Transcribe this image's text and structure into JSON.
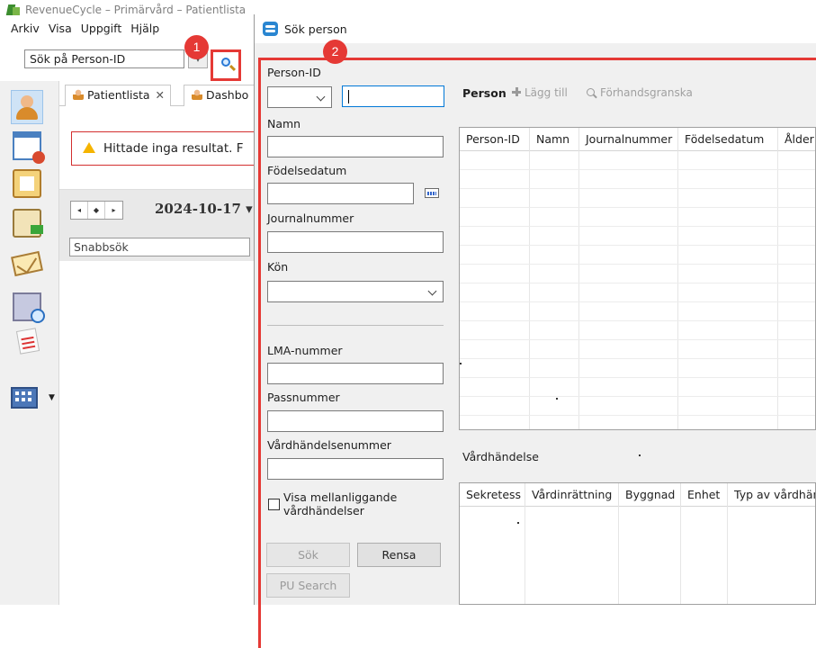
{
  "app": {
    "window_title": "RevenueCycle – Primärvård – Patientlista",
    "menu": [
      "Arkiv",
      "Visa",
      "Uppgift",
      "Hjälp"
    ],
    "search_placeholder": "Sök på Person-ID",
    "search_icon": "search-icon",
    "tabs": [
      {
        "label": "Patientlista",
        "close": "✕"
      },
      {
        "label": "Dashbo"
      }
    ],
    "alert_text": "Hittade inga resultat. F",
    "date": "2024-10-17",
    "date_nav": [
      "◂",
      "◆",
      "▸"
    ],
    "quick_search_placeholder": "Snabbsök",
    "sidebar_icons": [
      "user-search-icon",
      "calendar-clock-icon",
      "clipboard-icon",
      "paste-icon",
      "mail-icon",
      "building-search-icon",
      "note-icon",
      "building-grid-icon"
    ]
  },
  "markers": {
    "one": "1",
    "two": "2",
    "color": "#e53935"
  },
  "dialog": {
    "title": "Sök person",
    "form": {
      "person_id_label": "Person-ID",
      "person_id_value": "",
      "name_label": "Namn",
      "birthdate_label": "Födelsedatum",
      "journal_label": "Journalnummer",
      "gender_label": "Kön",
      "lma_label": "LMA-nummer",
      "passport_label": "Passnummer",
      "care_event_label": "Vårdhändelsenummer",
      "show_intermediate_label": "Visa mellanliggande vårdhändelser",
      "show_intermediate_checked": false,
      "search_button": "Sök",
      "clear_button": "Rensa",
      "pu_search_button": "PU Search"
    },
    "person_panel": {
      "title": "Person",
      "add": "Lägg till",
      "preview": "Förhandsgranska",
      "columns": [
        "Person-ID",
        "Namn",
        "Journalnummer",
        "Födelsedatum",
        "Ålder"
      ]
    },
    "care_event_panel": {
      "title": "Vårdhändelse",
      "columns": [
        "Sekretess",
        "Vårdinrättning",
        "Byggnad",
        "Enhet",
        "Typ av vårdhän"
      ]
    }
  }
}
